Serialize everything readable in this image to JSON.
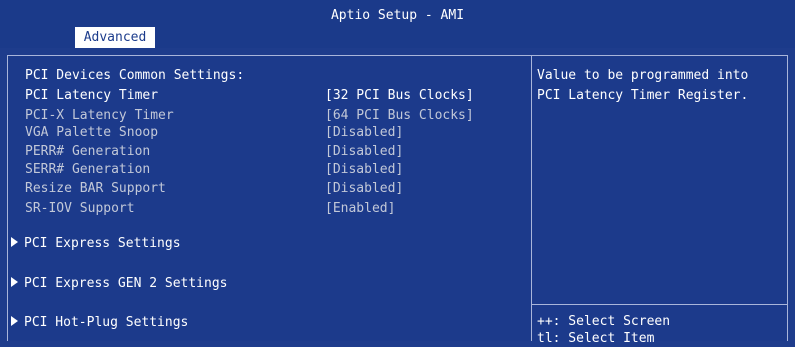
{
  "header": {
    "title": "Aptio Setup - AMI",
    "tab": "Advanced"
  },
  "main": {
    "section_title": "PCI Devices Common Settings:",
    "settings": [
      {
        "label": "PCI Latency Timer",
        "value": "[32 PCI Bus Clocks]",
        "selected": true
      },
      {
        "label": "PCI-X Latency Timer",
        "value": "[64 PCI Bus Clocks]",
        "selected": false
      },
      {
        "label": "VGA Palette Snoop",
        "value": "[Disabled]",
        "selected": false
      },
      {
        "label": "PERR# Generation",
        "value": "[Disabled]",
        "selected": false
      },
      {
        "label": "SERR# Generation",
        "value": "[Disabled]",
        "selected": false
      },
      {
        "label": "Resize BAR Support",
        "value": "[Disabled]",
        "selected": false
      },
      {
        "label": "SR-IOV Support",
        "value": "[Enabled]",
        "selected": false
      }
    ],
    "submenus": [
      {
        "label": "PCI Express Settings"
      },
      {
        "label": "PCI Express GEN 2 Settings"
      },
      {
        "label": "PCI Hot-Plug Settings"
      }
    ]
  },
  "help": {
    "lines": [
      "Value to be programmed into",
      "PCI Latency Timer Register."
    ]
  },
  "keys": [
    {
      "key": "++",
      "text": ": Select Screen"
    },
    {
      "key": "tl",
      "text": ": Select Item"
    }
  ],
  "colors": {
    "background": "#1e3c8c",
    "text": "#c2c8d8",
    "highlight": "#ffffff",
    "border": "#a9b5da"
  },
  "icons": {
    "submenu_arrow": "triangle-right-icon"
  }
}
